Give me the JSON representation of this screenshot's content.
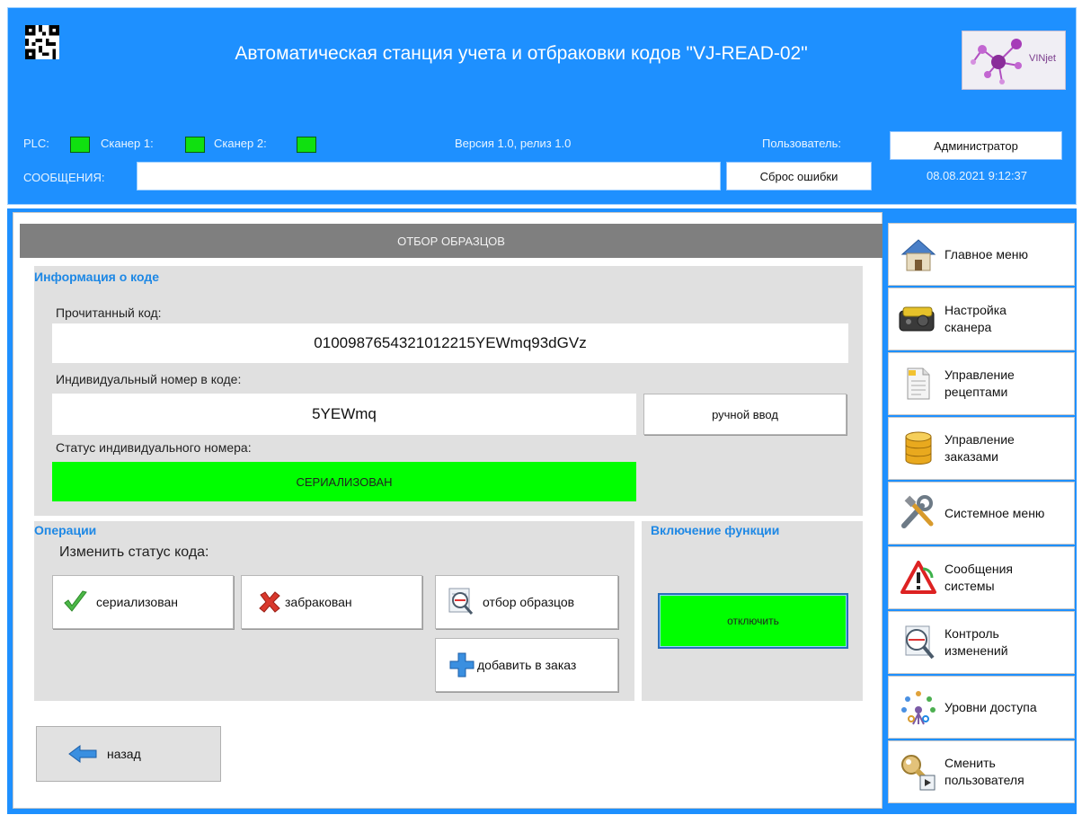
{
  "header": {
    "title": "Автоматическая станция учета и отбраковки кодов \"VJ-READ-02\"",
    "logo_text": "VINjet",
    "plc_label": "PLC:",
    "scanner1_label": "Сканер 1:",
    "scanner2_label": "Сканер 2:",
    "version": "Версия 1.0, релиз 1.0",
    "user_label": "Пользователь:",
    "user_value": "Администратор",
    "messages_label": "СООБЩЕНИЯ:",
    "messages_value": "",
    "reset_button": "Сброс ошибки",
    "datetime": "08.08.2021 9:12:37",
    "status_color": "#10e010"
  },
  "main": {
    "section_title": "ОТБОР ОБРАЗЦОВ",
    "code_info": {
      "heading": "Информация о коде",
      "read_code_label": "Прочитанный код:",
      "read_code_value": "0100987654321012215YEWmq93dGVz",
      "serial_label": "Индивидуальный номер в коде:",
      "serial_value": "5YEWmq",
      "manual_button": "ручной ввод",
      "status_label": "Статус индивидуального номера:",
      "status_value": "СЕРИАЛИЗОВАН",
      "status_color": "#00ff00"
    },
    "operations": {
      "heading": "Операции",
      "change_status_label": "Изменить статус кода:",
      "serialized_button": "сериализован",
      "rejected_button": "забракован",
      "sampling_button": "отбор образцов",
      "add_to_order_button": "добавить в заказ"
    },
    "function": {
      "heading": "Включение функции",
      "toggle_button": "отключить",
      "toggle_color": "#00ff00"
    },
    "back_button": "назад"
  },
  "sidebar": {
    "items": [
      {
        "label": "Главное меню",
        "icon": "home-icon"
      },
      {
        "label": "Настройка\nсканера",
        "icon": "scanner-icon"
      },
      {
        "label": "Управление\nрецептами",
        "icon": "document-icon"
      },
      {
        "label": "Управление\nзаказами",
        "icon": "database-icon"
      },
      {
        "label": "Системное меню",
        "icon": "tools-icon"
      },
      {
        "label": "Сообщения\nсистемы",
        "icon": "warning-icon"
      },
      {
        "label": "Контроль\nизменений",
        "icon": "magnifier-icon"
      },
      {
        "label": "Уровни доступа",
        "icon": "users-keys-icon"
      },
      {
        "label": "Сменить\nпользователя",
        "icon": "key-user-icon"
      }
    ]
  }
}
